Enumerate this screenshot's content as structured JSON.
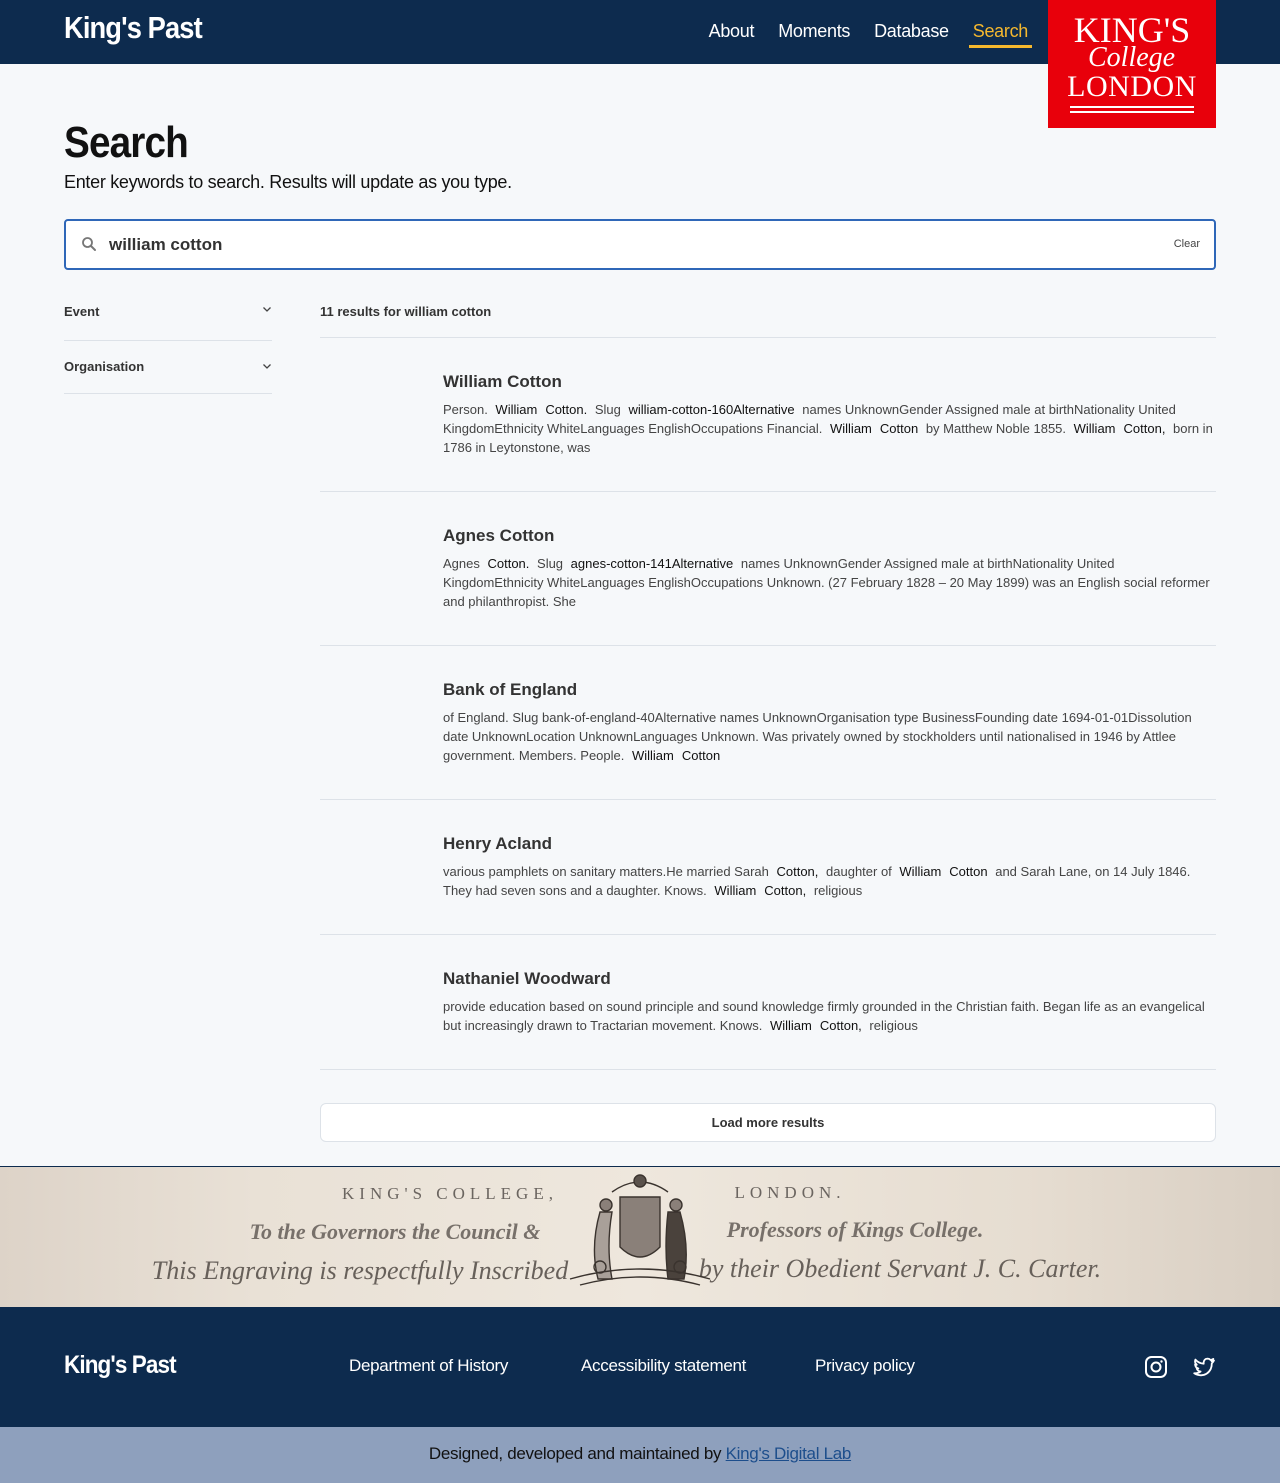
{
  "header": {
    "site_title": "King's Past",
    "nav": [
      "About",
      "Moments",
      "Database",
      "Search"
    ],
    "logo": {
      "line1": "KING'S",
      "line2": "College",
      "line3": "LONDON"
    }
  },
  "page": {
    "title": "Search",
    "subtitle": "Enter keywords to search. Results will update as you type."
  },
  "search": {
    "value": "william cotton",
    "clear_label": "Clear",
    "icon": "search-icon"
  },
  "filters": [
    {
      "label": "Event"
    },
    {
      "label": "Organisation"
    }
  ],
  "results": {
    "count_text": "11 results for william cotton",
    "items": [
      {
        "title": "William Cotton",
        "snippet": [
          {
            "t": "Person. "
          },
          {
            "h": "William"
          },
          {
            "h": "Cotton."
          },
          {
            "t": " Slug "
          },
          {
            "h": "william-cotton-160Alternative"
          },
          {
            "t": " names UnknownGender Assigned male at birthNationality United KingdomEthnicity WhiteLanguages EnglishOccupations Financial. "
          },
          {
            "h": "William"
          },
          {
            "h": "Cotton"
          },
          {
            "t": " by Matthew Noble 1855. "
          },
          {
            "h": "William"
          },
          {
            "h": "Cotton,"
          },
          {
            "t": " born in 1786 in Leytonstone, was"
          }
        ]
      },
      {
        "title": "Agnes Cotton",
        "snippet": [
          {
            "t": "Agnes "
          },
          {
            "h": "Cotton."
          },
          {
            "t": " Slug "
          },
          {
            "h": "agnes-cotton-141Alternative"
          },
          {
            "t": " names UnknownGender Assigned male at birthNationality United KingdomEthnicity WhiteLanguages EnglishOccupations Unknown. (27 February 1828 – 20 May 1899) was an English social reformer and philanthropist. She"
          }
        ]
      },
      {
        "title": "Bank of England",
        "snippet": [
          {
            "t": "of England. Slug bank-of-england-40Alternative names UnknownOrganisation type BusinessFounding date 1694-01-01Dissolution date UnknownLocation UnknownLanguages Unknown. Was privately owned by stockholders until nationalised in 1946 by Attlee government. Members. People. "
          },
          {
            "h": "William"
          },
          {
            "h": "Cotton"
          }
        ]
      },
      {
        "title": "Henry Acland",
        "snippet": [
          {
            "t": "various pamphlets on sanitary matters.He married Sarah "
          },
          {
            "h": "Cotton,"
          },
          {
            "t": " daughter of "
          },
          {
            "h": "William"
          },
          {
            "h": "Cotton"
          },
          {
            "t": " and Sarah Lane, on 14 July 1846. They had seven sons and a daughter. Knows. "
          },
          {
            "h": "William"
          },
          {
            "h": "Cotton,"
          },
          {
            "t": " religious"
          }
        ]
      },
      {
        "title": "Nathaniel Woodward",
        "snippet": [
          {
            "t": "provide education based on sound principle and sound knowledge firmly grounded in the Christian faith. Began life as an evangelical but increasingly drawn to Tractarian movement. Knows. "
          },
          {
            "h": "William"
          },
          {
            "h": "Cotton,"
          },
          {
            "t": " religious"
          }
        ]
      }
    ],
    "load_more_label": "Load more results"
  },
  "engraving": {
    "line1_left": "KING'S COLLEGE,",
    "line1_right": "LONDON.",
    "line2_left": "To the Governors the Council &",
    "line2_right": "Professors of Kings College.",
    "line3_left": "This Engraving is respectfully Inscribed",
    "line3_right": "by their Obedient Servant J. C. Carter."
  },
  "footer": {
    "site_title": "King's Past",
    "links": [
      "Department of History",
      "Accessibility statement",
      "Privacy policy"
    ],
    "social": [
      "instagram-icon",
      "twitter-icon"
    ],
    "credits_prefix": "Designed, developed and maintained by ",
    "credits_link": "King's Digital Lab"
  },
  "colors": {
    "navy": "#0d2b4e",
    "accent_yellow": "#f5b82e",
    "kcl_red": "#e8000b",
    "search_border": "#2f67b8",
    "credits_bg": "#8ea0bd"
  }
}
